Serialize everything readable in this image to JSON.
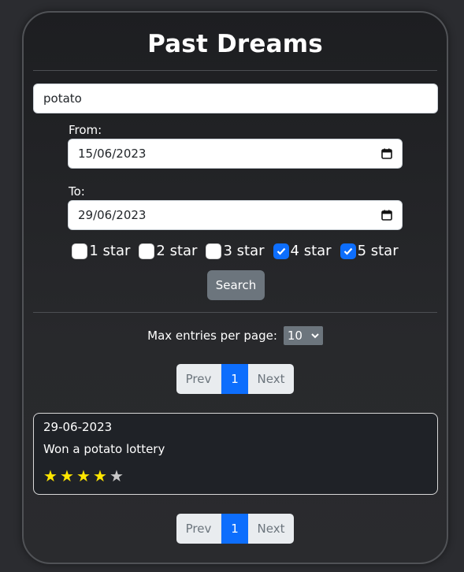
{
  "page": {
    "title": "Past Dreams"
  },
  "search": {
    "value": "potato"
  },
  "from": {
    "label": "From:",
    "value": "15/06/2023"
  },
  "to": {
    "label": "To:",
    "value": "29/06/2023"
  },
  "star_filters": [
    {
      "label": "1 star",
      "checked": false
    },
    {
      "label": "2 star",
      "checked": false
    },
    {
      "label": "3 star",
      "checked": false
    },
    {
      "label": "4 star",
      "checked": true
    },
    {
      "label": "5 star",
      "checked": true
    }
  ],
  "search_button": {
    "label": "Search"
  },
  "max_entries": {
    "label": "Max entries per page:",
    "value": "10"
  },
  "pagination": {
    "prev": "Prev",
    "current": "1",
    "next": "Next"
  },
  "entries": [
    {
      "date": "29-06-2023",
      "text": "Won a potato lottery",
      "rating": 4,
      "max_rating": 5
    }
  ],
  "colors": {
    "accent": "#0d6efd",
    "button_secondary": "#6c757d",
    "star_on": "#ffe600",
    "star_off": "#c8c8c8"
  }
}
